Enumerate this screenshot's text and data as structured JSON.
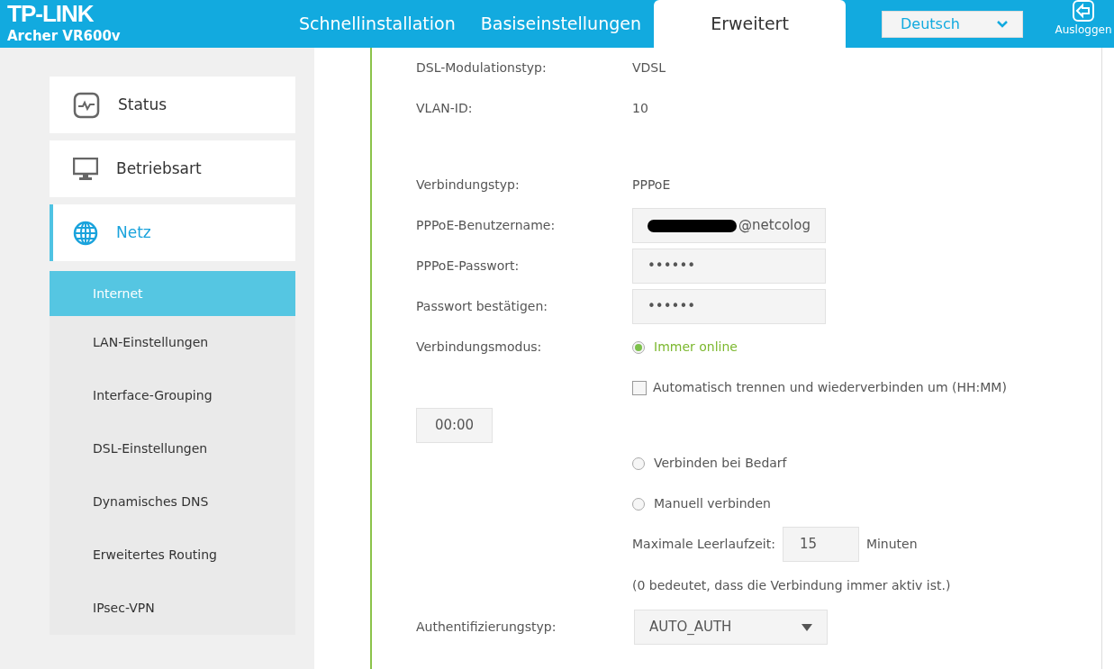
{
  "header": {
    "logo": "TP-LINK",
    "model": "Archer VR600v",
    "tabs": [
      {
        "label": "Schnellinstallation",
        "selected": false
      },
      {
        "label": "Basiseinstellungen",
        "selected": false
      },
      {
        "label": "Erweitert",
        "selected": true
      }
    ],
    "language": {
      "value": "Deutsch"
    },
    "logout": {
      "label": "Ausloggen"
    }
  },
  "sidebar": {
    "items": [
      {
        "label": "Status",
        "selected": false
      },
      {
        "label": "Betriebsart",
        "selected": false
      },
      {
        "label": "Netz",
        "selected": true
      }
    ],
    "subitems": [
      {
        "label": "Internet",
        "selected": true
      },
      {
        "label": "LAN-Einstellungen",
        "selected": false
      },
      {
        "label": "Interface-Grouping",
        "selected": false
      },
      {
        "label": "DSL-Einstellungen",
        "selected": false
      },
      {
        "label": "Dynamisches DNS",
        "selected": false
      },
      {
        "label": "Erweitertes Routing",
        "selected": false
      },
      {
        "label": "IPsec-VPN",
        "selected": false
      }
    ]
  },
  "form": {
    "sections": [
      [
        {
          "kind": "text",
          "label": "DSL-Modulationstyp:",
          "value": "VDSL"
        },
        {
          "kind": "text",
          "label": "VLAN-ID:",
          "value": "10"
        }
      ],
      [
        {
          "kind": "text",
          "label": "Verbindungstyp:",
          "value": "PPPoE"
        },
        {
          "kind": "redacted",
          "label": "PPPoE-Benutzername:",
          "value": "@netcolog"
        },
        {
          "kind": "password",
          "label": "PPPoE-Passwort:",
          "value": "••••••"
        },
        {
          "kind": "password",
          "label": "Passwort bestätigen:",
          "value": "••••••"
        },
        {
          "kind": "radio",
          "label": "Verbindungsmodus:",
          "option": "Immer online",
          "selected": true
        },
        {
          "kind": "checkbox",
          "option": "Automatisch trennen und wiederverbinden um (HH:MM)",
          "checked": false
        },
        {
          "kind": "time",
          "value": "00:00"
        },
        {
          "kind": "radio",
          "option": "Verbinden bei Bedarf",
          "selected": false
        },
        {
          "kind": "radio",
          "option": "Manuell verbinden",
          "selected": false
        },
        {
          "kind": "idle",
          "label": "Maximale Leerlaufzeit:",
          "value": "15",
          "unit": "Minuten"
        },
        {
          "kind": "note",
          "text": "(0 bedeutet, dass die Verbindung immer aktiv ist.)"
        },
        {
          "kind": "select",
          "label": "Authentifizierungstyp:",
          "value": "AUTO_AUTH"
        }
      ]
    ]
  }
}
